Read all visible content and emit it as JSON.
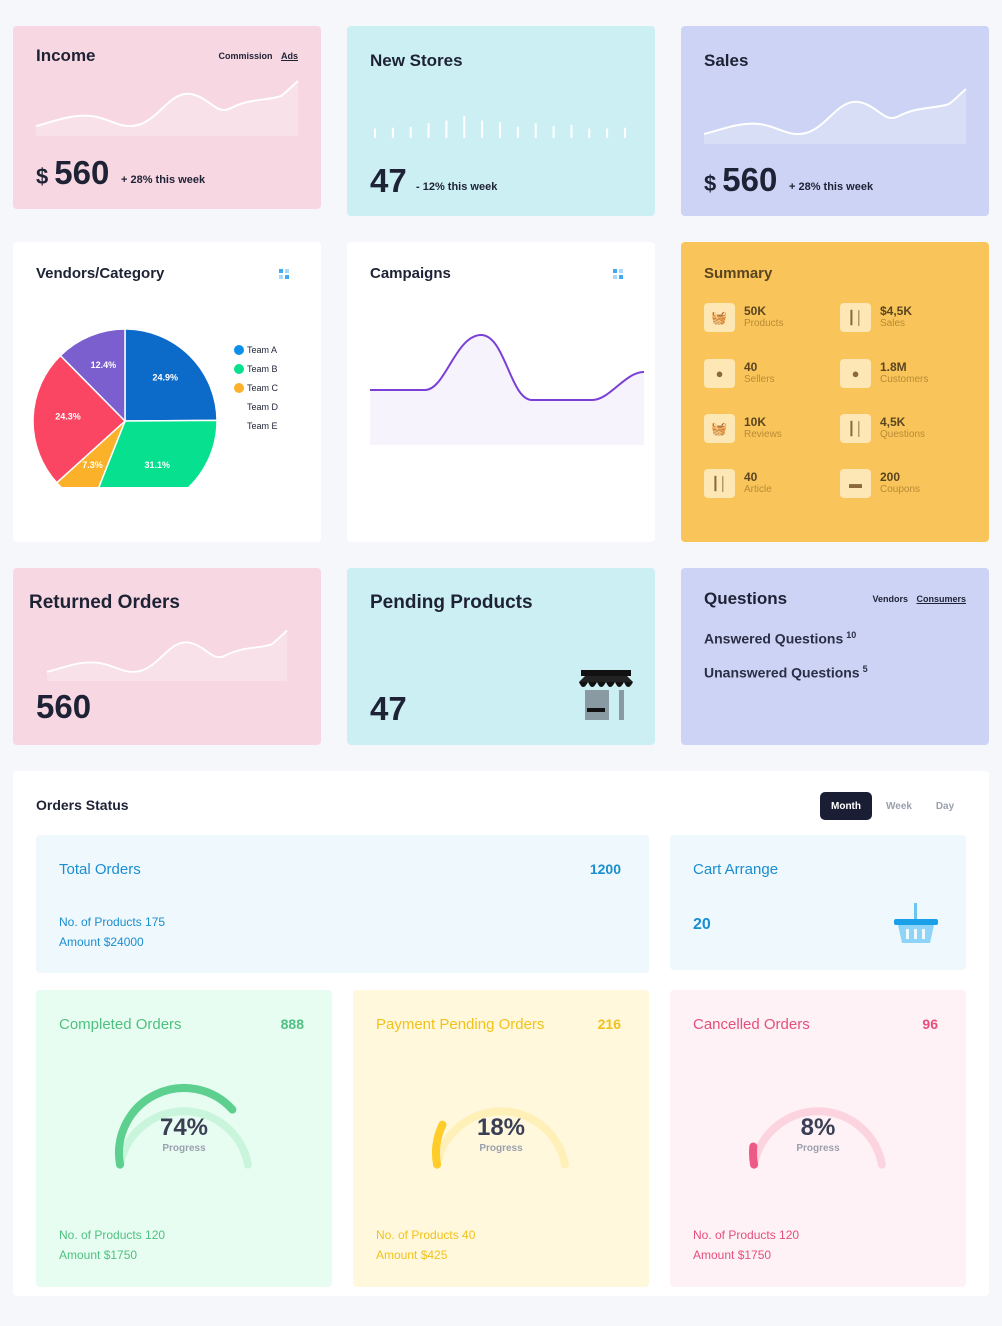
{
  "income": {
    "title": "Income",
    "tab_commission": "Commission",
    "tab_ads": "Ads",
    "currency": "$",
    "value": "560",
    "trend": "+ 28% this week"
  },
  "new_stores": {
    "title": "New Stores",
    "value": "47",
    "trend": "- 12% this week"
  },
  "sales": {
    "title": "Sales",
    "currency": "$",
    "value": "560",
    "trend": "+ 28% this week"
  },
  "vendors": {
    "title": "Vendors/Category",
    "menu_icon": "grid-dots-icon",
    "legend": [
      "Team A",
      "Team B",
      "Team C",
      "Team D",
      "Team E"
    ],
    "colors": [
      "#0c6ac9",
      "#06e08f",
      "#fbb12a",
      "#fb4663",
      "#7b5fcf"
    ]
  },
  "chart_data": {
    "type": "pie",
    "title": "Vendors/Category",
    "categories": [
      "Team A",
      "Team B",
      "Team C",
      "Team D",
      "Team E"
    ],
    "values": [
      24.9,
      31.1,
      7.3,
      24.3,
      12.4
    ],
    "labels": [
      "24.9%",
      "31.1%",
      "7.3%",
      "24.3%",
      "12.4%"
    ]
  },
  "campaigns": {
    "title": "Campaigns",
    "menu_icon": "grid-dots-icon",
    "line_color": "#7a3fd6"
  },
  "summary": {
    "title": "Summary",
    "items": [
      {
        "value": "50K",
        "label": "Products",
        "icon": "basket-icon"
      },
      {
        "value": "$4,5K",
        "label": "Sales",
        "icon": "bar-chart-icon"
      },
      {
        "value": "40",
        "label": "Sellers",
        "icon": "user-icon"
      },
      {
        "value": "1.8M",
        "label": "Customers",
        "icon": "user-icon"
      },
      {
        "value": "10K",
        "label": "Reviews",
        "icon": "basket-icon"
      },
      {
        "value": "4,5K",
        "label": "Questions",
        "icon": "bar-chart-icon"
      },
      {
        "value": "40",
        "label": "Article",
        "icon": "bar-chart-icon"
      },
      {
        "value": "200",
        "label": "Coupons",
        "icon": "card-icon"
      }
    ]
  },
  "returned": {
    "title": "Returned Orders",
    "value": "560"
  },
  "pending": {
    "title": "Pending Products",
    "value": "47",
    "icon": "storefront-icon"
  },
  "questions": {
    "title": "Questions",
    "tab_vendors": "Vendors",
    "tab_consumers": "Consumers",
    "answered_label": "Answered Questions",
    "answered_count": "10",
    "unanswered_label": "Unanswered Questions",
    "unanswered_count": "5"
  },
  "orders_status": {
    "title": "Orders Status",
    "tabs": [
      "Month",
      "Week",
      "Day"
    ],
    "active_tab": "Month",
    "total": {
      "title": "Total Orders",
      "count": "1200",
      "products": "No. of Products 175",
      "amount": "Amount $24000"
    },
    "cart": {
      "title": "Cart Arrange",
      "count": "20",
      "icon": "basket-icon"
    },
    "completed": {
      "title": "Completed Orders",
      "count": "888",
      "percent": "74%",
      "progress_label": "Progress",
      "fraction": 0.74,
      "products": "No. of Products 120",
      "amount": "Amount $1750",
      "color": "#5dcf8f"
    },
    "payment_pending": {
      "title": "Payment Pending Orders",
      "count": "216",
      "percent": "18%",
      "progress_label": "Progress",
      "fraction": 0.18,
      "products": "No. of Products 40",
      "amount": "Amount $425",
      "color": "#ffcc29"
    },
    "cancelled": {
      "title": "Cancelled Orders",
      "count": "96",
      "percent": "8%",
      "progress_label": "Progress",
      "fraction": 0.08,
      "products": "No. of Products 120",
      "amount": "Amount $1750",
      "color": "#ee5a85"
    }
  }
}
